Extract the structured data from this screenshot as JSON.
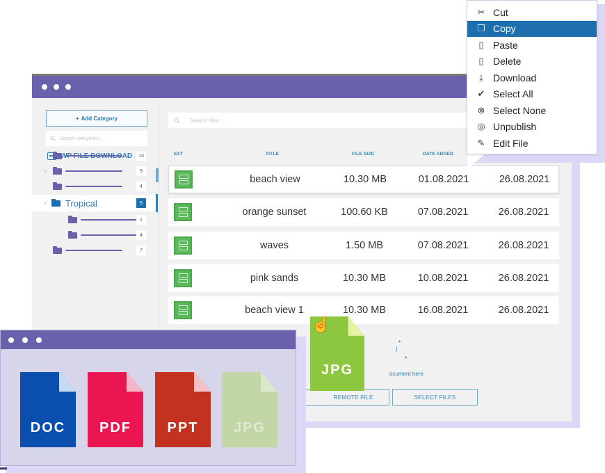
{
  "main_window": {
    "sidebar": {
      "add_category_label": "Add Category",
      "add_icon": "plus-icon",
      "search_placeholder": "Search categories...",
      "root_label": "WP FILE DOWNLOAD",
      "categories": [
        {
          "label": "",
          "count": "13",
          "level": 0,
          "expandable": false,
          "active": false
        },
        {
          "label": "",
          "count": "9",
          "level": 0,
          "expandable": true,
          "active": false
        },
        {
          "label": "",
          "count": "4",
          "level": 0,
          "expandable": false,
          "active": false
        },
        {
          "label": "Tropical",
          "count": "5",
          "level": 0,
          "expandable": true,
          "active": true
        },
        {
          "label": "",
          "count": "1",
          "level": 1,
          "expandable": false,
          "active": false
        },
        {
          "label": "",
          "count": "4",
          "level": 1,
          "expandable": false,
          "active": false
        },
        {
          "label": "",
          "count": "7",
          "level": 0,
          "expandable": false,
          "active": false
        }
      ]
    },
    "content": {
      "search_placeholder": "Search files...",
      "columns": [
        "EXT",
        "TITLE",
        "FILE SIZE",
        "DATE ADDED"
      ],
      "files": [
        {
          "ext_icon": "image-file-icon",
          "title": "beach view",
          "size": "10.30 MB",
          "added": "01.08.2021",
          "modified": "26.08.2021"
        },
        {
          "ext_icon": "image-file-icon",
          "title": "orange sunset",
          "size": "100.60 KB",
          "added": "07.08.2021",
          "modified": "26.08.2021"
        },
        {
          "ext_icon": "image-file-icon",
          "title": "waves",
          "size": "1.50 MB",
          "added": "07.08.2021",
          "modified": "26.08.2021"
        },
        {
          "ext_icon": "image-file-icon",
          "title": "pink sands",
          "size": "10.30 MB",
          "added": "10.08.2021",
          "modified": "26.08.2021"
        },
        {
          "ext_icon": "image-file-icon",
          "title": "beach view 1",
          "size": "10.30 MB",
          "added": "16.08.2021",
          "modified": "26.08.2021"
        }
      ],
      "drop_text": "ocument here",
      "remote_file_label": "REMOTE FILE",
      "select_files_label": "SELECT FILES"
    }
  },
  "context_menu": {
    "items": [
      {
        "label": "Cut",
        "icon": "scissors-icon",
        "glyph": "✂",
        "highlighted": false
      },
      {
        "label": "Copy",
        "icon": "copy-icon",
        "glyph": "❐",
        "highlighted": true
      },
      {
        "label": "Paste",
        "icon": "clipboard-icon",
        "glyph": "▯",
        "highlighted": false
      },
      {
        "label": "Delete",
        "icon": "trash-icon",
        "glyph": "▯",
        "highlighted": false
      },
      {
        "label": "Download",
        "icon": "download-icon",
        "glyph": "⤓",
        "highlighted": false
      },
      {
        "label": "Select All",
        "icon": "check-all-icon",
        "glyph": "✔",
        "highlighted": false
      },
      {
        "label": "Select None",
        "icon": "cancel-circle-icon",
        "glyph": "⊗",
        "highlighted": false
      },
      {
        "label": "Unpublish",
        "icon": "eye-off-icon",
        "glyph": "◎",
        "highlighted": false
      },
      {
        "label": "Edit File",
        "icon": "pencil-icon",
        "glyph": "✎",
        "highlighted": false
      }
    ]
  },
  "dragged_file": {
    "label": "JPG",
    "color": "#8dc63f",
    "fold_color": "#e4f2a6"
  },
  "file_types_window": {
    "types": [
      {
        "label": "DOC",
        "color": "#0b4fae",
        "fold_color": "#c6dcf4",
        "faded": false
      },
      {
        "label": "PDF",
        "color": "#ea1652",
        "fold_color": "#f7b6c7",
        "faded": false
      },
      {
        "label": "PPT",
        "color": "#c2321f",
        "fold_color": "#f4c1c7",
        "faded": false
      },
      {
        "label": "JPG",
        "color": "#c3d6a5",
        "fold_color": "#dde7cb",
        "faded": true
      }
    ]
  },
  "colors": {
    "accent_purple": "#6a61ad",
    "accent_blue": "#2e7fb8",
    "highlight_blue": "#1d6fae",
    "file_green": "#5cb85c"
  }
}
